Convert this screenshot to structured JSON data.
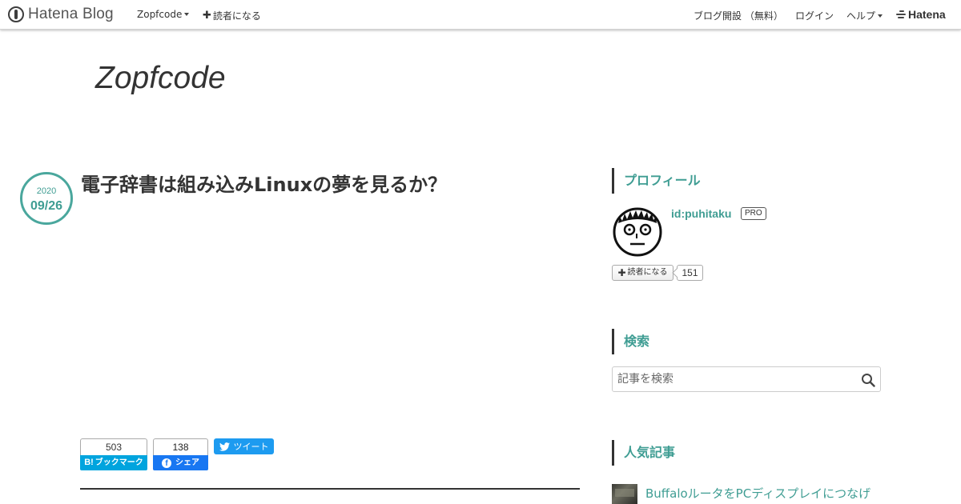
{
  "globalbar": {
    "logo": "Hatena Blog",
    "blog_menu": "Zopfcode",
    "subscribe": "読者になる",
    "open_blog": "ブログ開設 （無料）",
    "login": "ログイン",
    "help": "ヘルプ",
    "hatena": "Hatena"
  },
  "blog": {
    "title": "Zopfcode"
  },
  "entry": {
    "date_year": "2020",
    "date_md": "09/26",
    "title": "電子辞書は組み込みLinuxの夢を見るか？",
    "share": {
      "hatebu_count": "503",
      "hatebu_mark": "B!",
      "hatebu_label": "ブックマーク",
      "fb_count": "138",
      "fb_mark": "f",
      "fb_label": "シェア",
      "tweet_label": "ツイート"
    }
  },
  "sidebar": {
    "profile": {
      "heading": "プロフィール",
      "id": "id:puhitaku",
      "badge": "PRO",
      "subscribe_label": "読者になる",
      "subscriber_count": "151"
    },
    "search": {
      "heading": "検索",
      "placeholder": "記事を検索"
    },
    "popular": {
      "heading": "人気記事",
      "items": [
        {
          "title": "BuffaloルータをPCディスプレイにつなげ"
        }
      ]
    }
  },
  "colors": {
    "accent": "#3f9d93",
    "hatebu": "#00a4de",
    "facebook": "#1877f2",
    "twitter": "#1d9bf0"
  }
}
